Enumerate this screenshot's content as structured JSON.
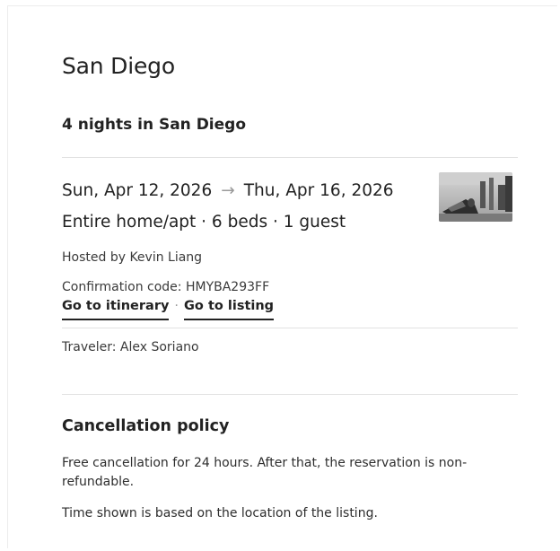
{
  "trip": {
    "city": "San Diego",
    "nights_title": "4 nights in San Diego"
  },
  "reservation": {
    "check_in": "Sun, Apr 12, 2026",
    "arrow": "→",
    "check_out": "Thu, Apr 16, 2026",
    "listing_summary": "Entire home/apt · 6 beds · 1 guest",
    "host_line": "Hosted by Kevin Liang",
    "confirmation_line": "Confirmation code: HMYBA293FF",
    "itinerary_link": "Go to itinerary",
    "separator": "·",
    "listing_link": "Go to listing",
    "traveler_line": "Traveler: Alex Soriano",
    "thumbnail_icon": "listing-photo"
  },
  "cancellation": {
    "title": "Cancellation policy",
    "policy_text": "Free cancellation for 24 hours. After that, the reservation is non-refundable.",
    "timezone_note": "Time shown is based on the location of the listing."
  }
}
